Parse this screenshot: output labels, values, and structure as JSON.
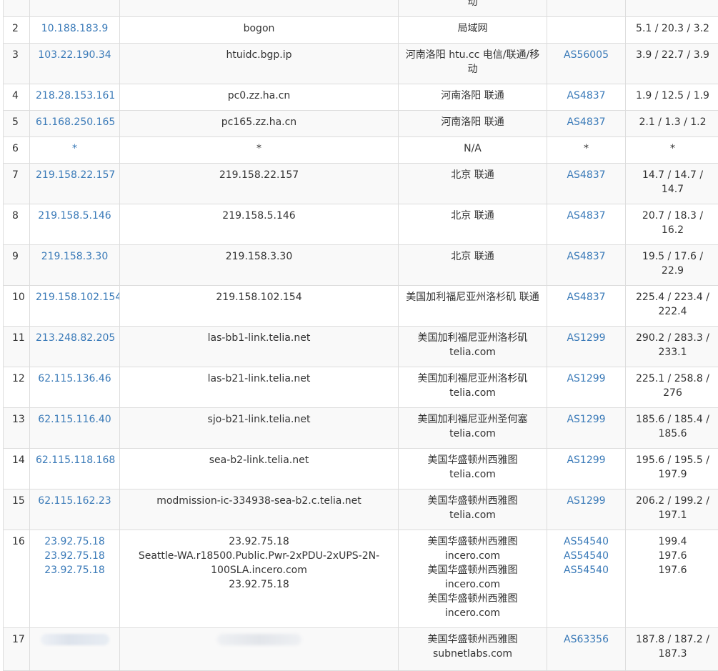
{
  "rows": [
    {
      "hop": "",
      "ip": [],
      "host": [],
      "location": [
        "动"
      ],
      "asn": [],
      "latency": ""
    },
    {
      "hop": "2",
      "ip": [
        "10.188.183.9"
      ],
      "host": [
        "bogon"
      ],
      "location": [
        "局域网"
      ],
      "asn": [],
      "latency": "5.1 / 20.3 / 3.2"
    },
    {
      "hop": "3",
      "ip": [
        "103.22.190.34"
      ],
      "host": [
        "htuidc.bgp.ip"
      ],
      "location": [
        "河南洛阳 htu.cc 电信/联通/移动"
      ],
      "asn": [
        "AS56005"
      ],
      "latency": "3.9 / 22.7 / 3.9"
    },
    {
      "hop": "4",
      "ip": [
        "218.28.153.161"
      ],
      "host": [
        "pc0.zz.ha.cn"
      ],
      "location": [
        "河南洛阳 联通"
      ],
      "asn": [
        "AS4837"
      ],
      "latency": "1.9 / 12.5 / 1.9"
    },
    {
      "hop": "5",
      "ip": [
        "61.168.250.165"
      ],
      "host": [
        "pc165.zz.ha.cn"
      ],
      "location": [
        "河南洛阳 联通"
      ],
      "asn": [
        "AS4837"
      ],
      "latency": "2.1 / 1.3 / 1.2"
    },
    {
      "hop": "6",
      "ip": [
        "*"
      ],
      "host": [
        "*"
      ],
      "location": [
        "N/A"
      ],
      "asn": [
        "*"
      ],
      "latency": "*"
    },
    {
      "hop": "7",
      "ip": [
        "219.158.22.157"
      ],
      "host": [
        "219.158.22.157"
      ],
      "location": [
        "北京 联通"
      ],
      "asn": [
        "AS4837"
      ],
      "latency": "14.7 / 14.7 / 14.7"
    },
    {
      "hop": "8",
      "ip": [
        "219.158.5.146"
      ],
      "host": [
        "219.158.5.146"
      ],
      "location": [
        "北京 联通"
      ],
      "asn": [
        "AS4837"
      ],
      "latency": "20.7 / 18.3 / 16.2"
    },
    {
      "hop": "9",
      "ip": [
        "219.158.3.30"
      ],
      "host": [
        "219.158.3.30"
      ],
      "location": [
        "北京 联通"
      ],
      "asn": [
        "AS4837"
      ],
      "latency": "19.5 / 17.6 / 22.9"
    },
    {
      "hop": "10",
      "ip": [
        "219.158.102.154"
      ],
      "host": [
        "219.158.102.154"
      ],
      "location": [
        "美国加利福尼亚州洛杉矶 联通"
      ],
      "asn": [
        "AS4837"
      ],
      "latency": "225.4 / 223.4 / 222.4"
    },
    {
      "hop": "11",
      "ip": [
        "213.248.82.205"
      ],
      "host": [
        "las-bb1-link.telia.net"
      ],
      "location": [
        "美国加利福尼亚州洛杉矶",
        "telia.com"
      ],
      "asn": [
        "AS1299"
      ],
      "latency": "290.2 / 283.3 / 233.1"
    },
    {
      "hop": "12",
      "ip": [
        "62.115.136.46"
      ],
      "host": [
        "las-b21-link.telia.net"
      ],
      "location": [
        "美国加利福尼亚州洛杉矶",
        "telia.com"
      ],
      "asn": [
        "AS1299"
      ],
      "latency": "225.1 / 258.8 / 276"
    },
    {
      "hop": "13",
      "ip": [
        "62.115.116.40"
      ],
      "host": [
        "sjo-b21-link.telia.net"
      ],
      "location": [
        "美国加利福尼亚州圣何塞",
        "telia.com"
      ],
      "asn": [
        "AS1299"
      ],
      "latency": "185.6 / 185.4 / 185.6"
    },
    {
      "hop": "14",
      "ip": [
        "62.115.118.168"
      ],
      "host": [
        "sea-b2-link.telia.net"
      ],
      "location": [
        "美国华盛顿州西雅图 telia.com"
      ],
      "asn": [
        "AS1299"
      ],
      "latency": "195.6 / 195.5 / 197.9"
    },
    {
      "hop": "15",
      "ip": [
        "62.115.162.23"
      ],
      "host": [
        "modmission-ic-334938-sea-b2.c.telia.net"
      ],
      "location": [
        "美国华盛顿州西雅图 telia.com"
      ],
      "asn": [
        "AS1299"
      ],
      "latency": "206.2 / 199.2 / 197.1"
    },
    {
      "hop": "16",
      "ip": [
        "23.92.75.18",
        "23.92.75.18",
        "23.92.75.18"
      ],
      "host": [
        "23.92.75.18",
        "Seattle-WA.r18500.Public.Pwr-2xPDU-2xUPS-2N-100SLA.incero.com",
        "23.92.75.18"
      ],
      "location": [
        "美国华盛顿州西雅图",
        "incero.com",
        "美国华盛顿州西雅图",
        "incero.com",
        "美国华盛顿州西雅图",
        "incero.com"
      ],
      "asn": [
        "AS54540",
        "AS54540",
        "AS54540"
      ],
      "latency": "199.4\n197.6\n197.6"
    },
    {
      "hop": "17",
      "ip": [],
      "host": [],
      "location": [
        "美国华盛顿州西雅图",
        "subnetlabs.com"
      ],
      "asn": [
        "AS63356"
      ],
      "latency": "187.8 / 187.2 / 187.3",
      "redacted": true
    }
  ]
}
